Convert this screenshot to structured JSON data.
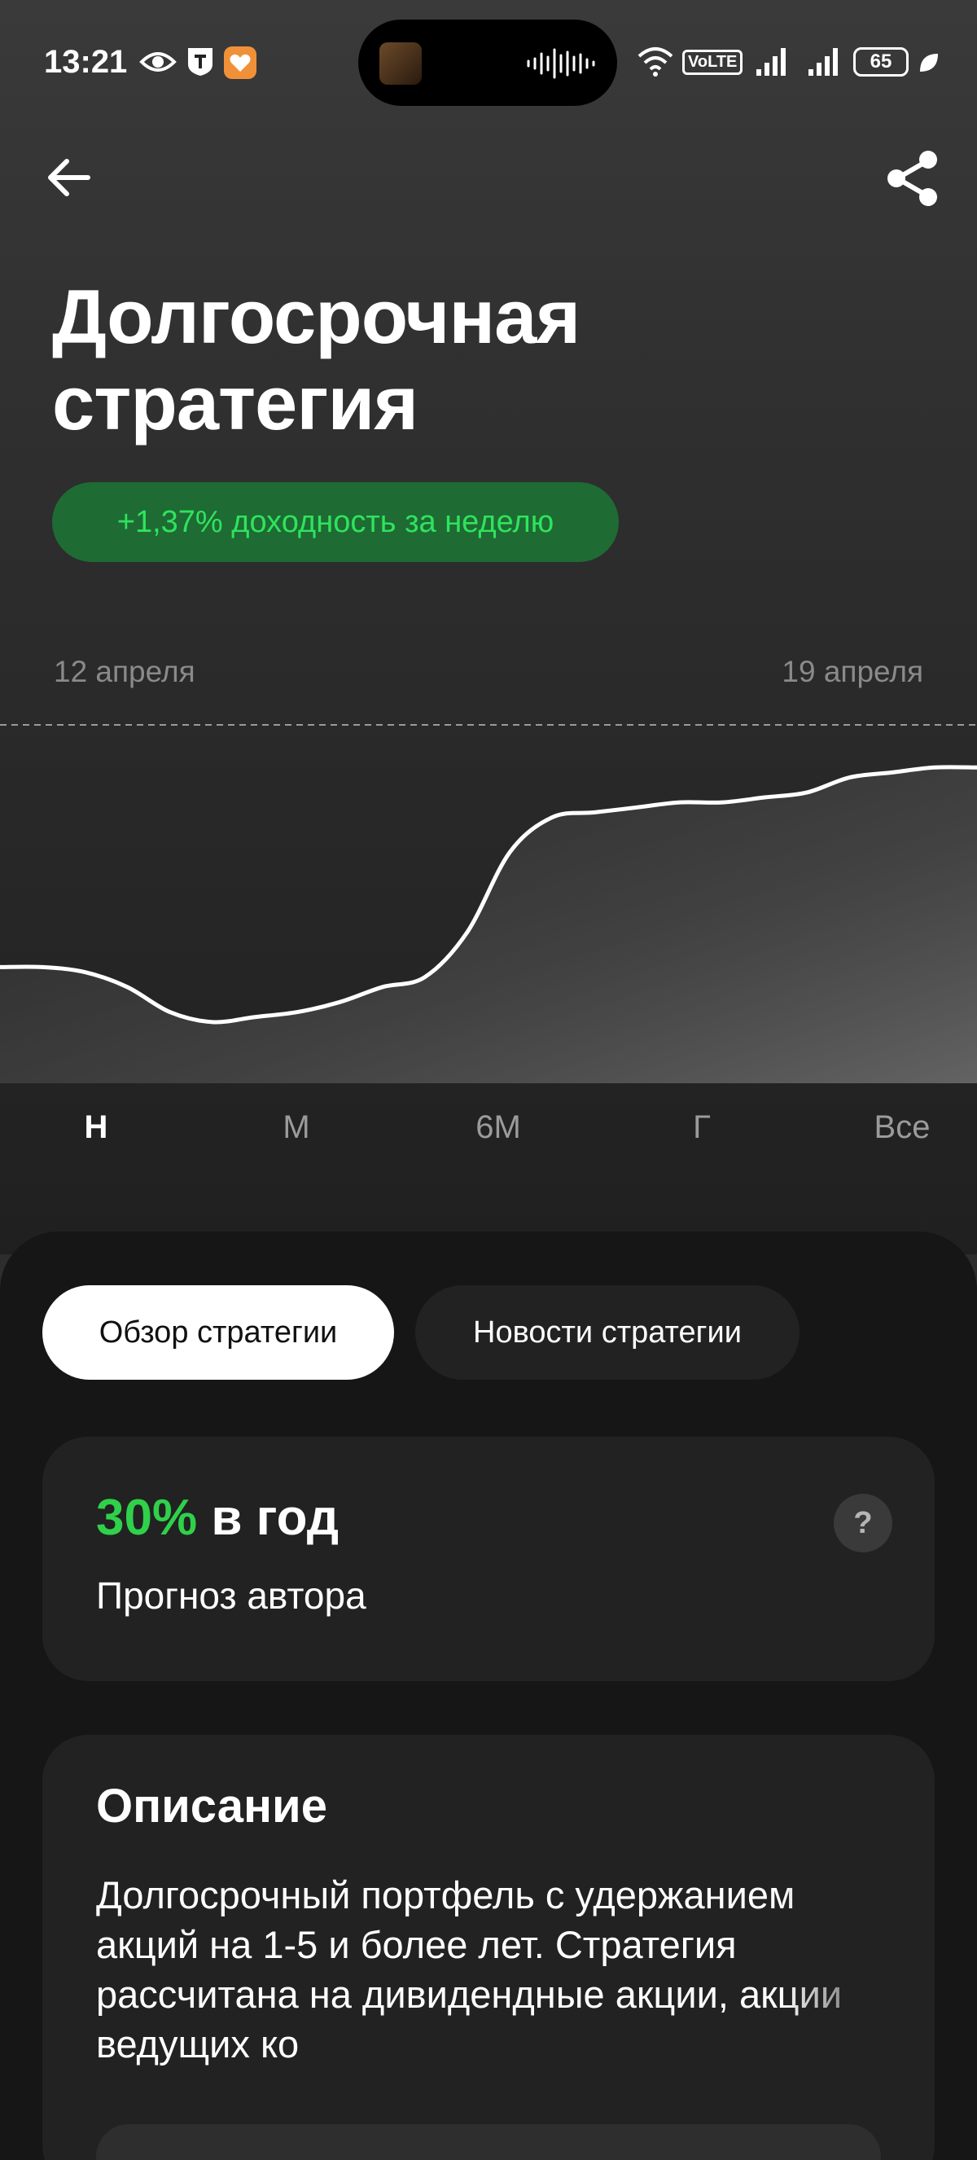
{
  "status_bar": {
    "time": "13:21",
    "network": "VoLTE",
    "battery": "65"
  },
  "header": {
    "title": "Долгосрочная стратегия",
    "yield_badge": "+1,37% доходность за неделю"
  },
  "chart_data": {
    "type": "line",
    "x_start_label": "12 апреля",
    "x_end_label": "19 апреля",
    "values": [
      50,
      50,
      49,
      46,
      41,
      39,
      40,
      41,
      43,
      46,
      48,
      57,
      73,
      80,
      81,
      82,
      83,
      83,
      84,
      85,
      88,
      89,
      90,
      90
    ],
    "grid": false,
    "baseline_dashed": true,
    "line_color": "#ffffff"
  },
  "periods": [
    "Н",
    "М",
    "6М",
    "Г",
    "Все"
  ],
  "active_period": "Н",
  "tabs": {
    "overview": "Обзор стратегии",
    "news": "Новости стратегии"
  },
  "forecast": {
    "percent": "30%",
    "unit": " в год",
    "label": "Прогноз автора",
    "help": "?"
  },
  "description": {
    "title": "Описание",
    "text": "Долгосрочный портфель с удержанием акций на 1-5 и более лет. Стратегия рассчитана на дивидендные акции, акции ведущих ко"
  },
  "colors": {
    "accent_green": "#2fd14a",
    "badge_bg": "#1e6b34",
    "sheet_bg": "#161616",
    "card_bg": "#222222"
  }
}
